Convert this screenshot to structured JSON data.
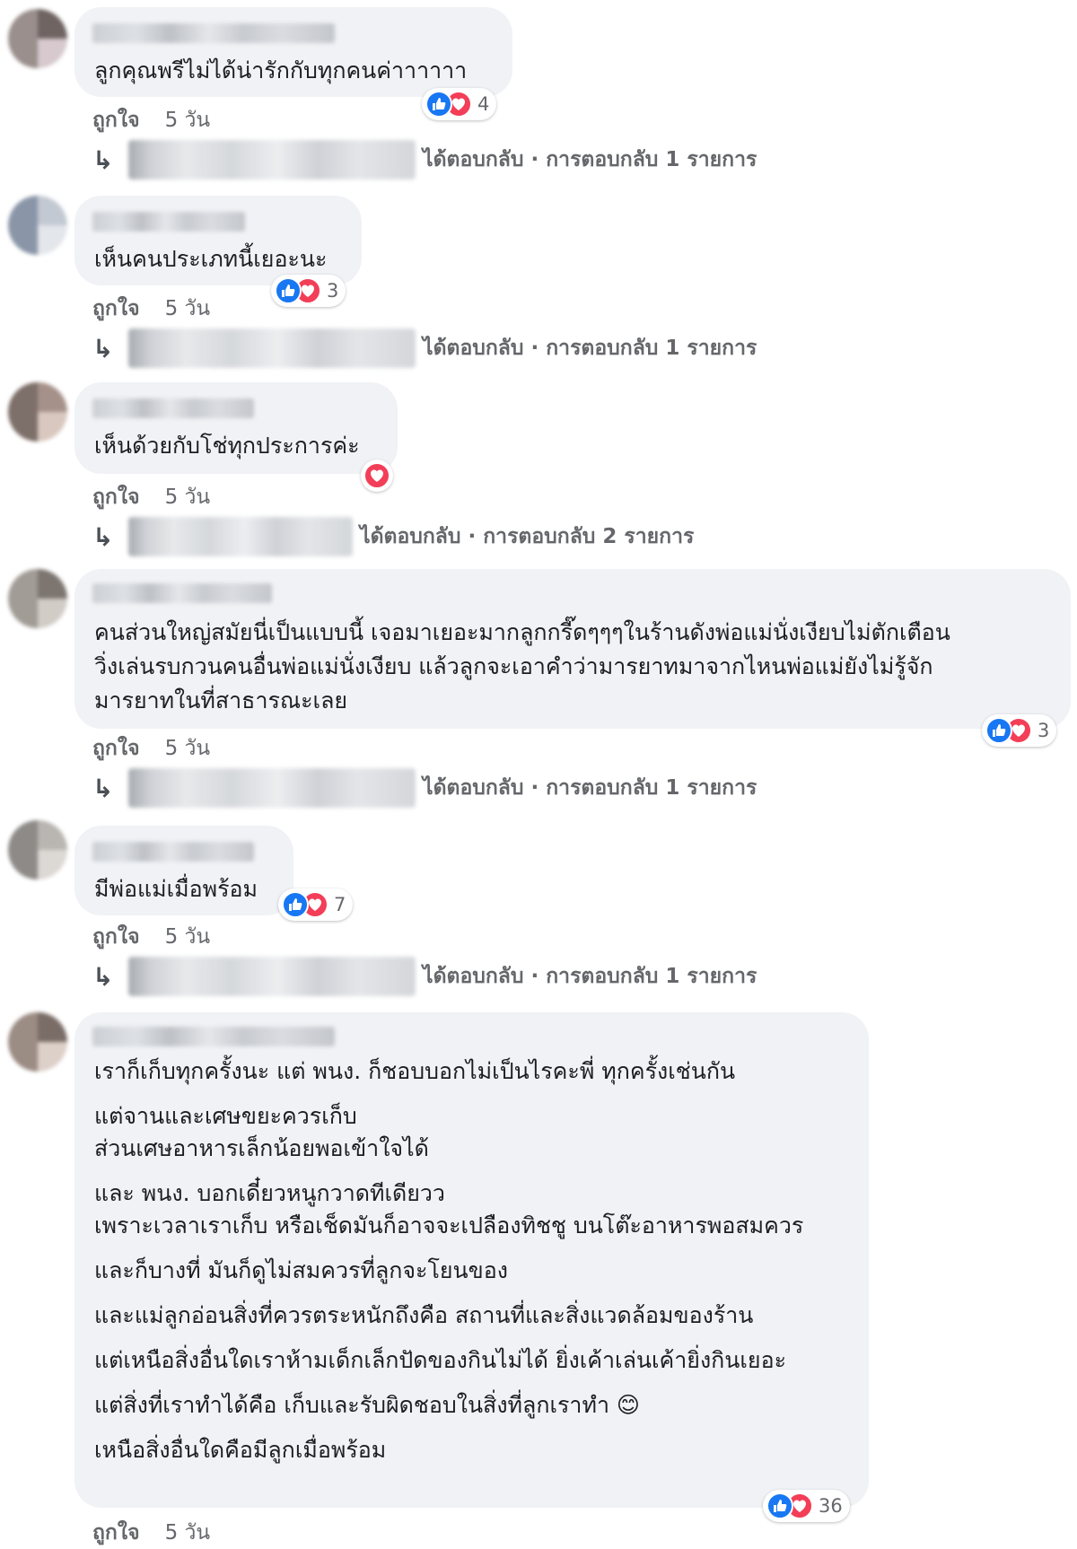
{
  "labels": {
    "like": "ถูกใจ",
    "time": "5 วัน"
  },
  "comments": [
    {
      "lines": [
        "ลูกคุณพรีไม่ได้น่ารักกับทุกคนค่าาาาาา"
      ],
      "reactions": [
        "like",
        "love"
      ],
      "reaction_count": "4",
      "reply_text": "ได้ตอบกลับ · การตอบกลับ 1 รายการ"
    },
    {
      "lines": [
        "เห็นคนประเภทนี้เยอะนะ"
      ],
      "reactions": [
        "like",
        "love"
      ],
      "reaction_count": "3",
      "reply_text": "ได้ตอบกลับ · การตอบกลับ 1 รายการ"
    },
    {
      "lines": [
        "เห็นด้วยกับโช่ทุกประการค่ะ"
      ],
      "reactions": [
        "love"
      ],
      "reaction_count": "",
      "reply_text": "ได้ตอบกลับ · การตอบกลับ 2 รายการ"
    },
    {
      "lines": [
        "คนส่วนใหญ่สมัยนี่เป็นแบบนี้ เจอมาเยอะมากลูกกรี๊ดๆๆๆในร้านดังพ่อแม่นั่งเงียบไม่ตักเตือน",
        "วิ่งเล่นรบกวนคนอื่นพ่อแม่นั่งเงียบ แล้วลูกจะเอาคำว่ามารยาทมาจากไหนพ่อแม่ยังไม่รู้จัก",
        "มารยาทในที่สาธารณะเลย"
      ],
      "reactions": [
        "like",
        "love"
      ],
      "reaction_count": "3",
      "reply_text": "ได้ตอบกลับ · การตอบกลับ 1 รายการ"
    },
    {
      "lines": [
        "มีพ่อแม่เมื่อพร้อม"
      ],
      "reactions": [
        "like",
        "love"
      ],
      "reaction_count": "7",
      "reply_text": "ได้ตอบกลับ · การตอบกลับ 1 รายการ"
    },
    {
      "lines": [
        "เราก็เก็บทุกครั้งนะ แต่ พนง. ก็ชอบบอกไม่เป็นไรคะพี่ ทุกครั้งเช่นกัน",
        "แต่จานและเศษขยะควรเก็บ",
        "ส่วนเศษอาหารเล็กน้อยพอเข้าใจได้",
        "และ พนง. บอกเดี๋ยวหนูกวาดทีเดียวว",
        "เพราะเวลาเราเก็บ หรือเช็ดมันก็อาจจะเปลืองทิชชู บนโต๊ะอาหารพอสมควร",
        "และก็บางที่ มันก็ดูไม่สมควรที่ลูกจะโยนของ",
        "และแม่ลูกอ่อนสิ่งที่ควรตระหนักถึงคือ สถานที่และสิ่งแวดล้อมของร้าน",
        "แต่เหนือสิ่งอื่นใดเราห้ามเด็กเล็กปัดของกินไม่ได้ ยิ่งเค้าเล่นเค้ายิ่งกินเยอะ",
        "แต่สิ่งที่เราทำได้คือ เก็บและรับผิดชอบในสิ่งที่ลูกเราทำ 😊",
        "เหนือสิ่งอื่นใดคือมีลูกเมื่อพร้อม"
      ],
      "reactions": [
        "like",
        "love"
      ],
      "reaction_count": "36",
      "reply_text": ""
    }
  ],
  "colors": {
    "bubble": "#f0f2f5",
    "like": "#1877f2",
    "love": "#f33e58",
    "meta": "#65676b"
  }
}
